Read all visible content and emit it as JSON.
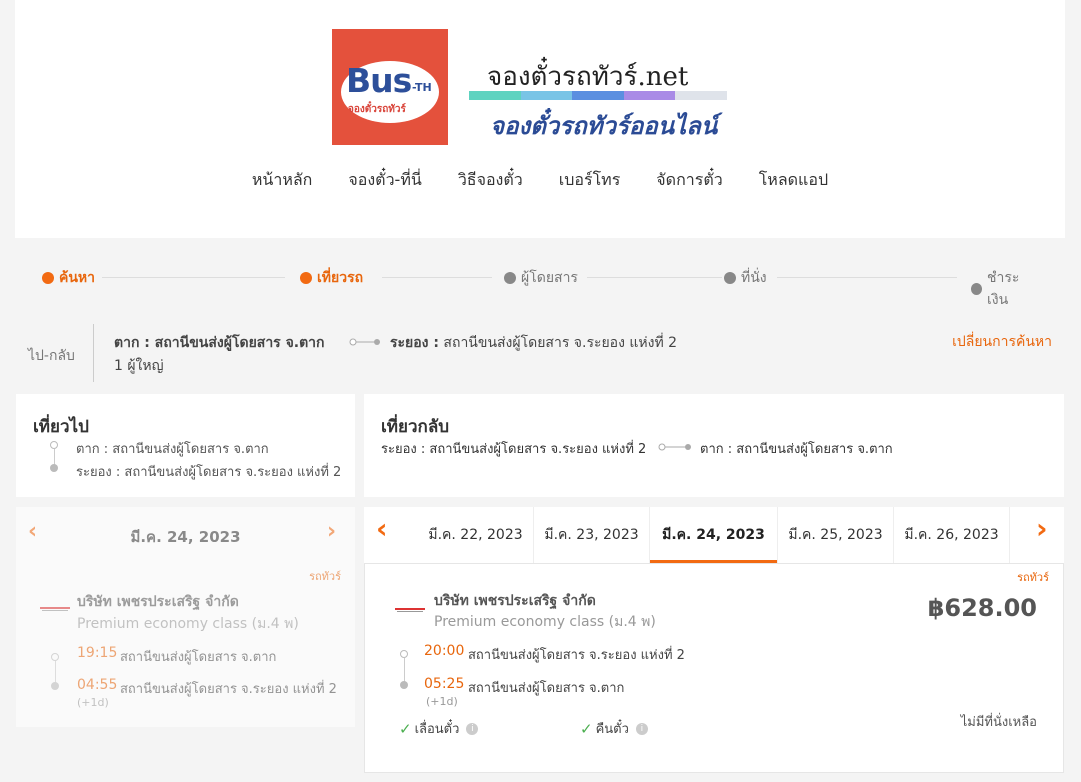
{
  "brand": {
    "logo_text": "Bus",
    "logo_suffix": "-TH",
    "logo_sub": "จองตั๋วรถทัวร์",
    "site_name": "จองตั๋วรถทัวร์.net",
    "tagline": "จองตั๋วรถทัวร์ออนไลน์",
    "bar_colors": [
      "#5fd3c0",
      "#79c4e6",
      "#5b8fe0",
      "#a98be6",
      "#dfe3ea"
    ]
  },
  "nav": [
    "หน้าหลัก",
    "จองตั๋ว-ที่นี่",
    "วิธีจองตั๋ว",
    "เบอร์โทร",
    "จัดการตั๋ว",
    "โหลดแอป"
  ],
  "steps": [
    {
      "label": "ค้นหา",
      "active": true
    },
    {
      "label": "เที่ยวรถ",
      "active": true
    },
    {
      "label": "ผู้โดยสาร",
      "active": false
    },
    {
      "label": "ที่นั่ง",
      "active": false
    },
    {
      "label": "ชำระเงิน",
      "active": false
    }
  ],
  "trip": {
    "type": "ไป-กลับ",
    "from": "ตาก : สถานีขนส่งผู้โดยสาร จ.ตาก",
    "to_prefix": "ระยอง :",
    "to_rest": " สถานีขนส่งผู้โดยสาร จ.ระยอง แห่งที่ 2",
    "passengers": "1 ผู้ใหญ่",
    "change_search": "เปลี่ยนการค้นหา"
  },
  "outbound": {
    "title": "เที่ยวไป",
    "from": "ตาก : สถานีขนส่งผู้โดยสาร จ.ตาก",
    "to": "ระยอง : สถานีขนส่งผู้โดยสาร จ.ระยอง แห่งที่ 2",
    "date": "มี.ค. 24, 2023",
    "result": {
      "bus_type": "รถทัวร์",
      "operator": "บริษัท เพชรประเสริฐ จำกัด",
      "class": "Premium economy class (ม.4 พ)",
      "depart_time": "19:15",
      "depart_stop": "สถานีขนส่งผู้โดยสาร จ.ตาก",
      "arrive_time": "04:55",
      "arrive_stop": "สถานีขนส่งผู้โดยสาร จ.ระยอง แห่งที่ 2",
      "next_day": "(+1d)"
    }
  },
  "return": {
    "title": "เที่ยวกลับ",
    "from": "ระยอง : สถานีขนส่งผู้โดยสาร จ.ระยอง แห่งที่ 2",
    "to": "ตาก : สถานีขนส่งผู้โดยสาร จ.ตาก",
    "dates": [
      "มี.ค. 22, 2023",
      "มี.ค. 23, 2023",
      "มี.ค. 24, 2023",
      "มี.ค. 25, 2023",
      "มี.ค. 26, 2023"
    ],
    "selected_date": "มี.ค. 24, 2023",
    "result": {
      "bus_type": "รถทัวร์",
      "operator": "บริษัท เพชรประเสริฐ จำกัด",
      "class": "Premium economy class (ม.4 พ)",
      "price": "฿628.00",
      "depart_time": "20:00",
      "depart_stop": "สถานีขนส่งผู้โดยสาร จ.ระยอง แห่งที่ 2",
      "arrive_time": "05:25",
      "arrive_stop": "สถานีขนส่งผู้โดยสาร จ.ตาก",
      "next_day": "(+1d)",
      "postpone": "เลื่อนตั๋ว",
      "refund": "คืนตั๋ว",
      "availability": "ไม่มีที่นั่งเหลือ"
    }
  },
  "colors": {
    "accent": "#f26a12",
    "check": "#4caf50"
  }
}
